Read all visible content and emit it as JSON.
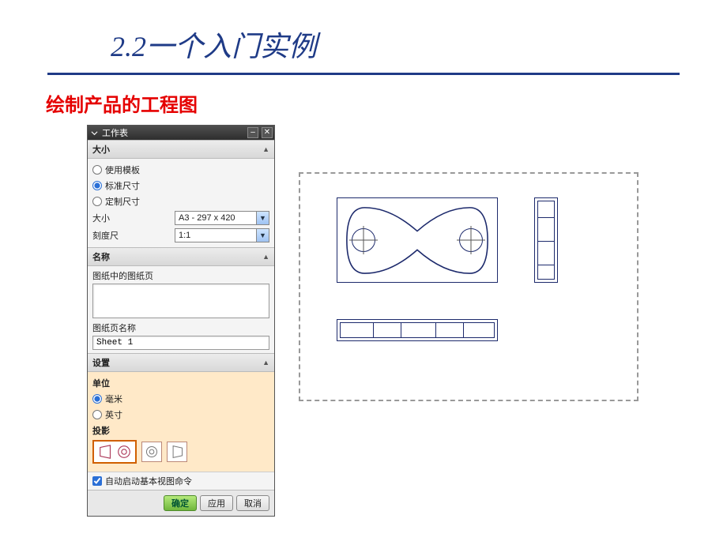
{
  "slide": {
    "title": "2.2一个入门实例",
    "subtitle": "绘制产品的工程图"
  },
  "dialog": {
    "title": "工作表",
    "sections": {
      "size": {
        "header": "大小",
        "opt_template": "使用模板",
        "opt_standard": "标准尺寸",
        "opt_custom": "定制尺寸",
        "size_label": "大小",
        "size_value": "A3 - 297 x 420",
        "scale_label": "刻度尺",
        "scale_value": "1:1"
      },
      "name": {
        "header": "名称",
        "in_drawing_label": "图纸中的图纸页",
        "sheet_name_label": "图纸页名称",
        "sheet_name_value": "Sheet 1"
      },
      "settings": {
        "header": "设置",
        "units_label": "单位",
        "unit_mm": "毫米",
        "unit_inch": "英寸",
        "projection_label": "投影"
      }
    },
    "autostart": "自动启动基本视图命令",
    "buttons": {
      "ok": "确定",
      "apply": "应用",
      "cancel": "取消"
    }
  }
}
